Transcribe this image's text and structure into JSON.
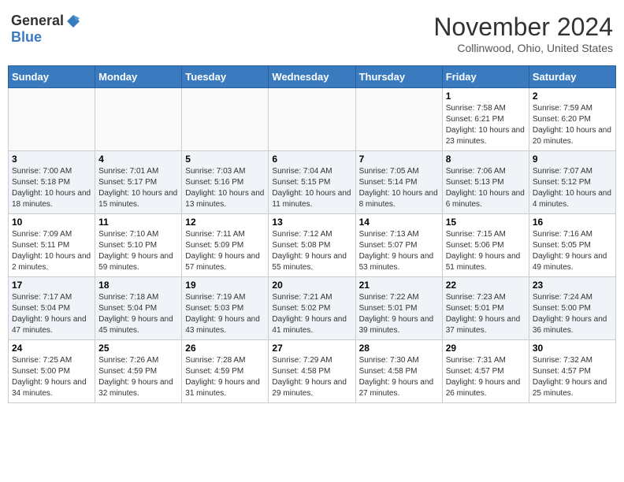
{
  "logo": {
    "general": "General",
    "blue": "Blue"
  },
  "title": "November 2024",
  "location": "Collinwood, Ohio, United States",
  "days_of_week": [
    "Sunday",
    "Monday",
    "Tuesday",
    "Wednesday",
    "Thursday",
    "Friday",
    "Saturday"
  ],
  "weeks": [
    [
      {
        "day": "",
        "info": ""
      },
      {
        "day": "",
        "info": ""
      },
      {
        "day": "",
        "info": ""
      },
      {
        "day": "",
        "info": ""
      },
      {
        "day": "",
        "info": ""
      },
      {
        "day": "1",
        "info": "Sunrise: 7:58 AM\nSunset: 6:21 PM\nDaylight: 10 hours and 23 minutes."
      },
      {
        "day": "2",
        "info": "Sunrise: 7:59 AM\nSunset: 6:20 PM\nDaylight: 10 hours and 20 minutes."
      }
    ],
    [
      {
        "day": "3",
        "info": "Sunrise: 7:00 AM\nSunset: 5:18 PM\nDaylight: 10 hours and 18 minutes."
      },
      {
        "day": "4",
        "info": "Sunrise: 7:01 AM\nSunset: 5:17 PM\nDaylight: 10 hours and 15 minutes."
      },
      {
        "day": "5",
        "info": "Sunrise: 7:03 AM\nSunset: 5:16 PM\nDaylight: 10 hours and 13 minutes."
      },
      {
        "day": "6",
        "info": "Sunrise: 7:04 AM\nSunset: 5:15 PM\nDaylight: 10 hours and 11 minutes."
      },
      {
        "day": "7",
        "info": "Sunrise: 7:05 AM\nSunset: 5:14 PM\nDaylight: 10 hours and 8 minutes."
      },
      {
        "day": "8",
        "info": "Sunrise: 7:06 AM\nSunset: 5:13 PM\nDaylight: 10 hours and 6 minutes."
      },
      {
        "day": "9",
        "info": "Sunrise: 7:07 AM\nSunset: 5:12 PM\nDaylight: 10 hours and 4 minutes."
      }
    ],
    [
      {
        "day": "10",
        "info": "Sunrise: 7:09 AM\nSunset: 5:11 PM\nDaylight: 10 hours and 2 minutes."
      },
      {
        "day": "11",
        "info": "Sunrise: 7:10 AM\nSunset: 5:10 PM\nDaylight: 9 hours and 59 minutes."
      },
      {
        "day": "12",
        "info": "Sunrise: 7:11 AM\nSunset: 5:09 PM\nDaylight: 9 hours and 57 minutes."
      },
      {
        "day": "13",
        "info": "Sunrise: 7:12 AM\nSunset: 5:08 PM\nDaylight: 9 hours and 55 minutes."
      },
      {
        "day": "14",
        "info": "Sunrise: 7:13 AM\nSunset: 5:07 PM\nDaylight: 9 hours and 53 minutes."
      },
      {
        "day": "15",
        "info": "Sunrise: 7:15 AM\nSunset: 5:06 PM\nDaylight: 9 hours and 51 minutes."
      },
      {
        "day": "16",
        "info": "Sunrise: 7:16 AM\nSunset: 5:05 PM\nDaylight: 9 hours and 49 minutes."
      }
    ],
    [
      {
        "day": "17",
        "info": "Sunrise: 7:17 AM\nSunset: 5:04 PM\nDaylight: 9 hours and 47 minutes."
      },
      {
        "day": "18",
        "info": "Sunrise: 7:18 AM\nSunset: 5:04 PM\nDaylight: 9 hours and 45 minutes."
      },
      {
        "day": "19",
        "info": "Sunrise: 7:19 AM\nSunset: 5:03 PM\nDaylight: 9 hours and 43 minutes."
      },
      {
        "day": "20",
        "info": "Sunrise: 7:21 AM\nSunset: 5:02 PM\nDaylight: 9 hours and 41 minutes."
      },
      {
        "day": "21",
        "info": "Sunrise: 7:22 AM\nSunset: 5:01 PM\nDaylight: 9 hours and 39 minutes."
      },
      {
        "day": "22",
        "info": "Sunrise: 7:23 AM\nSunset: 5:01 PM\nDaylight: 9 hours and 37 minutes."
      },
      {
        "day": "23",
        "info": "Sunrise: 7:24 AM\nSunset: 5:00 PM\nDaylight: 9 hours and 36 minutes."
      }
    ],
    [
      {
        "day": "24",
        "info": "Sunrise: 7:25 AM\nSunset: 5:00 PM\nDaylight: 9 hours and 34 minutes."
      },
      {
        "day": "25",
        "info": "Sunrise: 7:26 AM\nSunset: 4:59 PM\nDaylight: 9 hours and 32 minutes."
      },
      {
        "day": "26",
        "info": "Sunrise: 7:28 AM\nSunset: 4:59 PM\nDaylight: 9 hours and 31 minutes."
      },
      {
        "day": "27",
        "info": "Sunrise: 7:29 AM\nSunset: 4:58 PM\nDaylight: 9 hours and 29 minutes."
      },
      {
        "day": "28",
        "info": "Sunrise: 7:30 AM\nSunset: 4:58 PM\nDaylight: 9 hours and 27 minutes."
      },
      {
        "day": "29",
        "info": "Sunrise: 7:31 AM\nSunset: 4:57 PM\nDaylight: 9 hours and 26 minutes."
      },
      {
        "day": "30",
        "info": "Sunrise: 7:32 AM\nSunset: 4:57 PM\nDaylight: 9 hours and 25 minutes."
      }
    ]
  ]
}
